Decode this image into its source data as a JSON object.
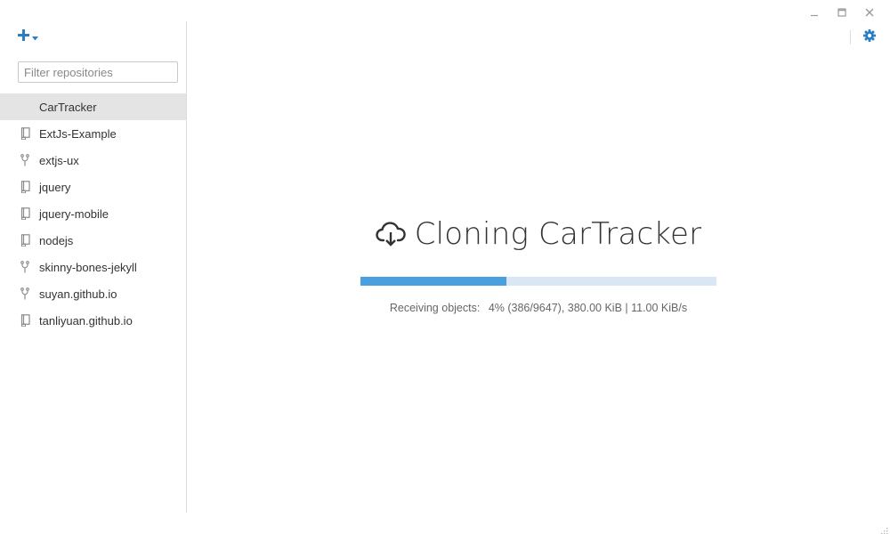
{
  "window": {
    "controls": [
      {
        "name": "minimize",
        "icon": "minimize-icon"
      },
      {
        "name": "maximize",
        "icon": "maximize-icon"
      },
      {
        "name": "close",
        "icon": "close-icon"
      }
    ]
  },
  "sidebar": {
    "add_icon": "plus-icon",
    "add_dropdown_icon": "caret-down-icon",
    "filter": {
      "placeholder": "Filter repositories",
      "value": ""
    },
    "repositories": [
      {
        "label": "CarTracker",
        "type": "none",
        "selected": true
      },
      {
        "label": "ExtJs-Example",
        "type": "repo"
      },
      {
        "label": "extjs-ux",
        "type": "fork"
      },
      {
        "label": "jquery",
        "type": "repo"
      },
      {
        "label": "jquery-mobile",
        "type": "repo"
      },
      {
        "label": "nodejs",
        "type": "repo"
      },
      {
        "label": "skinny-bones-jekyll",
        "type": "fork"
      },
      {
        "label": "suyan.github.io",
        "type": "fork"
      },
      {
        "label": "tanliyuan.github.io",
        "type": "repo"
      }
    ]
  },
  "toolbar": {
    "settings_icon": "gear-icon"
  },
  "clone": {
    "icon": "cloud-download-icon",
    "title": "Cloning CarTracker",
    "progress_fraction": 0.41,
    "status_label": "Receiving objects:",
    "status_detail": "4% (386/9647), 380.00 KiB | 11.00 KiB/s"
  },
  "colors": {
    "accent": "#4a9fe0",
    "progress_track": "#d9e7f5",
    "selected_bg": "#e4e4e4",
    "icon_blue": "#2b7ec1"
  }
}
